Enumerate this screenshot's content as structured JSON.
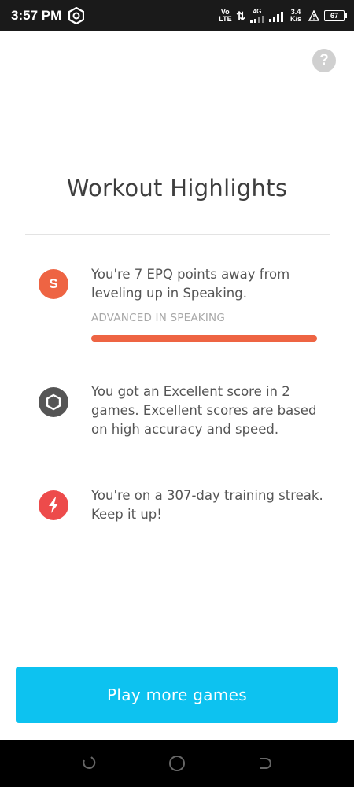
{
  "status_bar": {
    "time": "3:57 PM",
    "network_line1": "Vo",
    "network_line2": "LTE",
    "network_type": "4G",
    "speed_value": "3.4",
    "speed_unit": "K/s",
    "battery": "67"
  },
  "help": {
    "label": "?"
  },
  "page": {
    "title": "Workout Highlights"
  },
  "highlights": [
    {
      "icon": "speaking-s-badge-icon",
      "icon_letter": "S",
      "icon_color": "#ee6443",
      "text": "You're 7 EPQ points away from leveling up in Speaking.",
      "level_label": "ADVANCED IN SPEAKING",
      "progress_fraction": 1.0
    },
    {
      "icon": "hexagon-excellent-icon",
      "icon_color": "#555555",
      "text": "You got an Excellent score in 2 games. Excellent scores are based on high accuracy and speed."
    },
    {
      "icon": "lightning-bolt-icon",
      "icon_color": "#ed4b4b",
      "text": "You're on a 307-day training streak. Keep it up!"
    }
  ],
  "cta": {
    "label": "Play more games",
    "color": "#0dc2f0"
  }
}
